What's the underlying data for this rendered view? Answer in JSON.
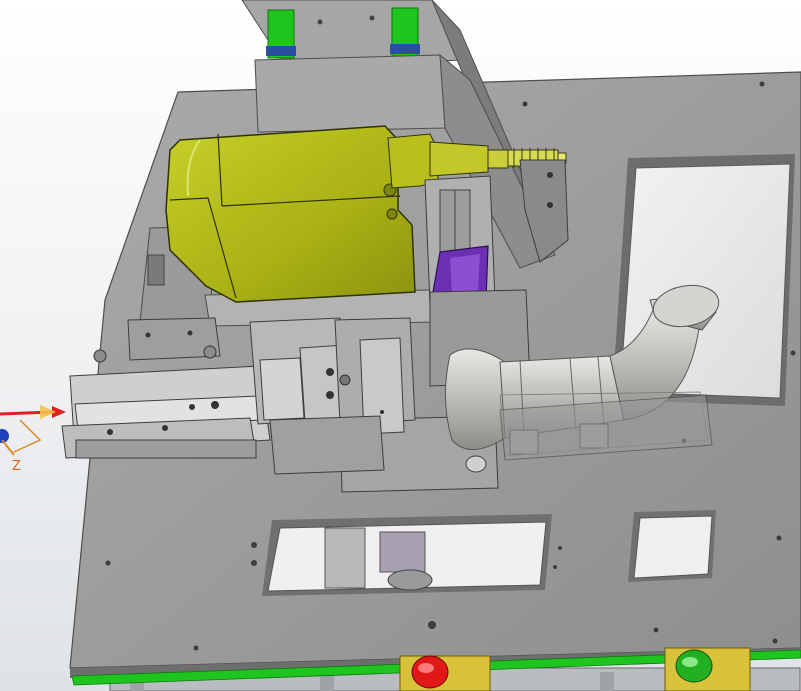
{
  "viewport": {
    "background_top": "#ffffff",
    "background_bottom": "#dfe2e6"
  },
  "model": {
    "plate_color": "#9c9c9c",
    "plate_edge_color": "#5a5a5a",
    "motor_color": "#b5bd1c",
    "clamp_color": "#6b2fb3",
    "rail_color": "#1fc41f",
    "pipe_color": "#c7c7c2",
    "stop_button_colors": [
      "#e01818",
      "#22b022"
    ]
  },
  "triad": {
    "z_label": "Z",
    "x_axis_color": "#e02020",
    "y_axis_color": "#2040c0",
    "z_axis_color": "#d98a20"
  }
}
